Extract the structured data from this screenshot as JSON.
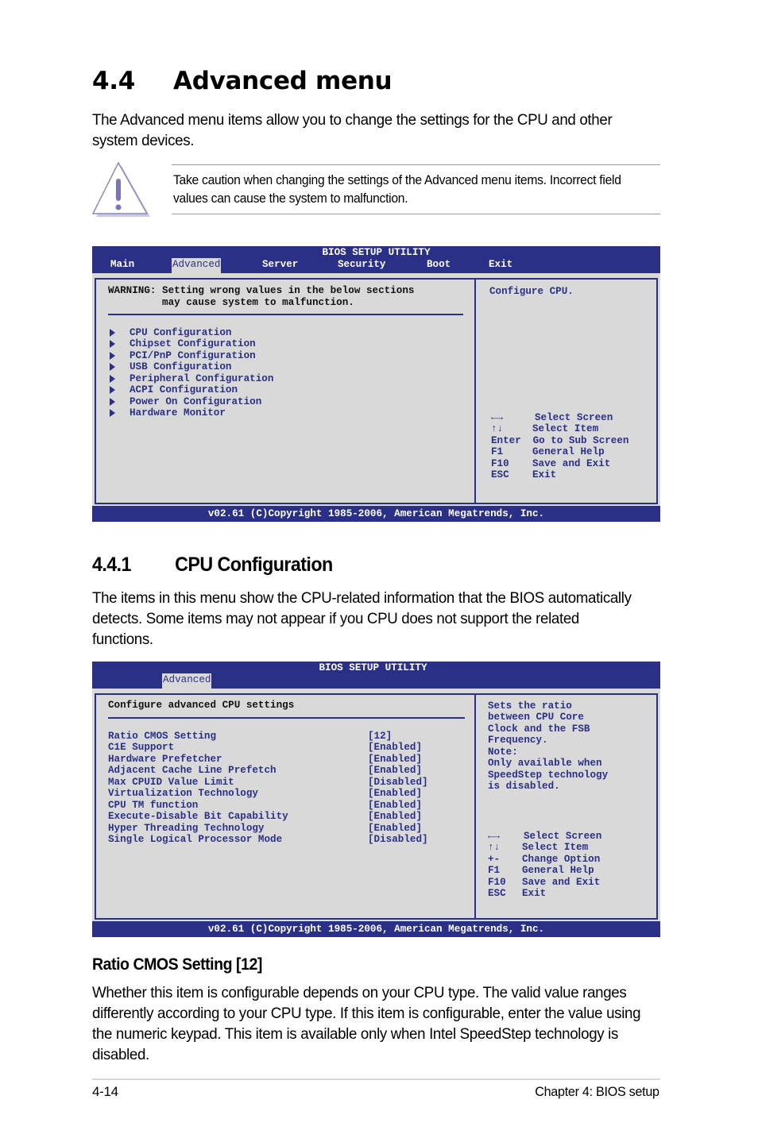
{
  "section": {
    "number": "4.4",
    "title": "Advanced menu",
    "intro": "The Advanced menu items allow you to change the settings for the CPU and other system devices."
  },
  "caution": {
    "icon": "warning-triangle-icon",
    "text": "Take caution when changing the settings of the Advanced menu items. Incorrect field values can cause the system to malfunction."
  },
  "bios1": {
    "title": "BIOS SETUP UTILITY",
    "tabs": [
      {
        "label": "Main",
        "active": false
      },
      {
        "label": "Advanced",
        "active": true
      },
      {
        "label": "Server",
        "active": false
      },
      {
        "label": "Security",
        "active": false
      },
      {
        "label": "Boot",
        "active": false
      },
      {
        "label": "Exit",
        "active": false
      }
    ],
    "warning_line1": "WARNING: Setting wrong values in the below sections",
    "warning_line2": "         may cause system to malfunction.",
    "menu_items": [
      "CPU Configuration",
      "Chipset Configuration",
      "PCI/PnP Configuration",
      "USB Configuration",
      "Peripheral Configuration",
      "ACPI Configuration",
      "Power On Configuration",
      "Hardware Monitor"
    ],
    "help_text": "Configure CPU.",
    "keys": [
      {
        "key": "←→",
        "action": "Select Screen"
      },
      {
        "key": "↑↓",
        "action": "Select Item"
      },
      {
        "key": "Enter",
        "action": "Go to Sub Screen"
      },
      {
        "key": "F1",
        "action": "General Help"
      },
      {
        "key": "F10",
        "action": "Save and Exit"
      },
      {
        "key": "ESC",
        "action": "Exit"
      }
    ],
    "footer": "v02.61 (C)Copyright 1985-2006, American Megatrends, Inc."
  },
  "subsection": {
    "number": "4.4.1",
    "title": "CPU Configuration",
    "intro": "The items in this menu show the CPU-related information that the BIOS automatically detects. Some items may not appear if you CPU does not support the related functions."
  },
  "bios2": {
    "title": "BIOS SETUP UTILITY",
    "active_tab": "Advanced",
    "heading": "Configure advanced CPU settings",
    "settings": [
      {
        "name": "Ratio CMOS Setting",
        "value": "[12]"
      },
      {
        "name": "C1E Support",
        "value": "[Enabled]"
      },
      {
        "name": "Hardware Prefetcher",
        "value": "[Enabled]"
      },
      {
        "name": "Adjacent Cache Line Prefetch",
        "value": "[Enabled]"
      },
      {
        "name": "Max CPUID Value Limit",
        "value": "[Disabled]"
      },
      {
        "name": "Virtualization Technology",
        "value": "[Enabled]"
      },
      {
        "name": "CPU TM function",
        "value": "[Enabled]"
      },
      {
        "name": "Execute-Disable Bit Capability",
        "value": "[Enabled]"
      },
      {
        "name": "Hyper Threading Technology",
        "value": "[Enabled]"
      },
      {
        "name": "Single Logical Processor Mode",
        "value": "[Disabled]"
      }
    ],
    "help_lines": [
      "Sets the ratio",
      "between CPU Core",
      "Clock and the FSB",
      "Frequency.",
      "Note:",
      "Only available when",
      "SpeedStep technology",
      "is disabled."
    ],
    "keys": [
      {
        "key": "←→",
        "action": "Select Screen"
      },
      {
        "key": "↑↓",
        "action": "Select Item"
      },
      {
        "key": "+-",
        "action": "Change Option"
      },
      {
        "key": "F1",
        "action": "General Help"
      },
      {
        "key": "F10",
        "action": "Save and Exit"
      },
      {
        "key": "ESC",
        "action": "Exit"
      }
    ],
    "footer": "v02.61 (C)Copyright 1985-2006, American Megatrends, Inc."
  },
  "item_ratio": {
    "title": "Ratio CMOS Setting [12]",
    "description": "Whether this item is configurable depends on your CPU type. The valid value ranges differently according to your CPU type. If this item is configurable, enter the value using the numeric keypad. This item is available only when Intel SpeedStep technology is disabled."
  },
  "page_footer": {
    "page_number": "4-14",
    "chapter": "Chapter 4: BIOS setup"
  }
}
